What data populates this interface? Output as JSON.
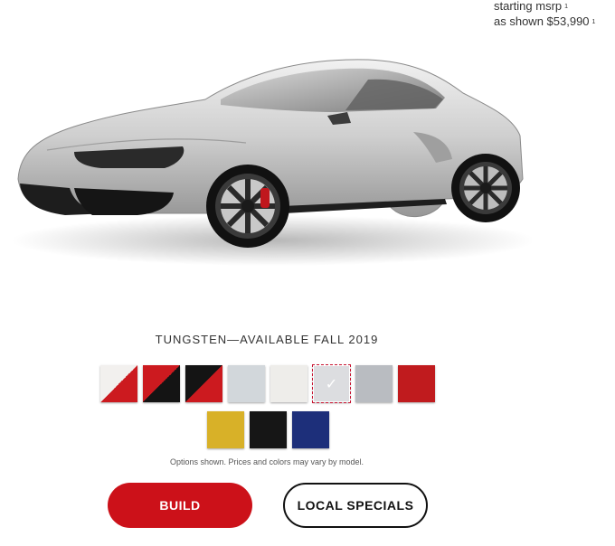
{
  "price": {
    "starting_label": "starting msrp",
    "starting_marker": "1",
    "shown_label": "as shown $53,990",
    "shown_marker": "1"
  },
  "vehicle": {
    "selected_color_name": "TUNGSTEN—AVAILABLE FALL 2019",
    "image_subject": "car-image"
  },
  "swatches": {
    "row1": [
      {
        "name": "swatch-white-red-two-tone",
        "top": "#cc1a1f",
        "bottom": "#f2f0ee",
        "selected": false
      },
      {
        "name": "swatch-black-red-two-tone",
        "top": "#141414",
        "bottom": "#cc1a1f",
        "selected": false
      },
      {
        "name": "swatch-red-black-two-tone",
        "top": "#cc1a1f",
        "bottom": "#141414",
        "selected": false
      },
      {
        "name": "swatch-light-silver",
        "color": "#d2d7db",
        "selected": false
      },
      {
        "name": "swatch-white",
        "color": "#eeedea",
        "selected": false
      },
      {
        "name": "swatch-tungsten",
        "color": "#dcdde0",
        "selected": true
      },
      {
        "name": "swatch-gray",
        "color": "#b9bcc1",
        "selected": false
      },
      {
        "name": "swatch-red",
        "color": "#c01b1e",
        "selected": false
      }
    ],
    "row2": [
      {
        "name": "swatch-yellow",
        "color": "#d8b128",
        "selected": false
      },
      {
        "name": "swatch-black",
        "color": "#161616",
        "selected": false
      },
      {
        "name": "swatch-blue",
        "color": "#1d2f7a",
        "selected": false
      }
    ],
    "check_glyph": "✓"
  },
  "note": "Options shown. Prices and colors may vary by model.",
  "buttons": {
    "build_label": "BUILD",
    "build_color": "#cc1119",
    "local_label": "LOCAL SPECIALS"
  }
}
